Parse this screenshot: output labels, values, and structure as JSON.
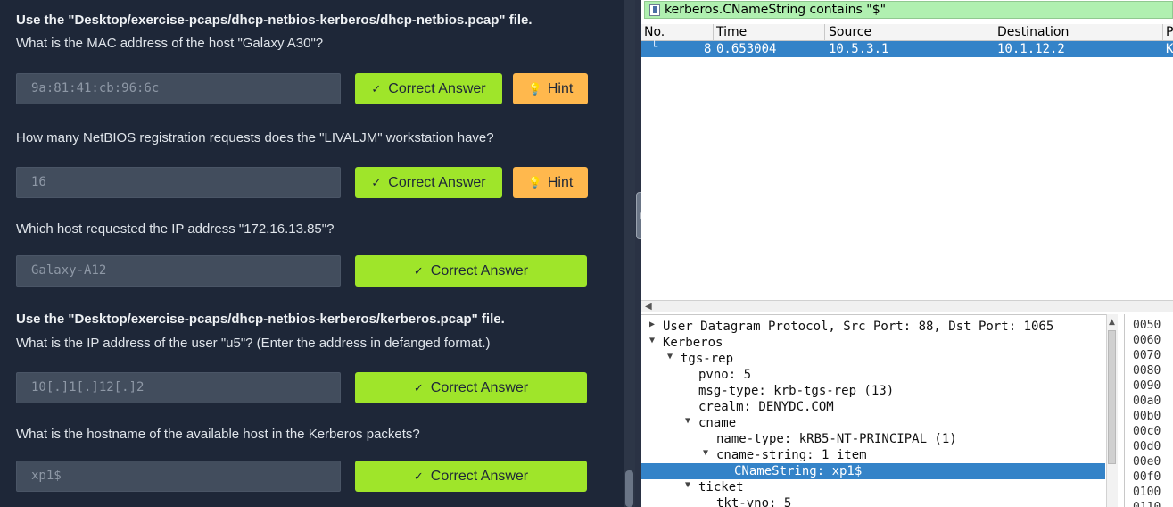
{
  "quiz": {
    "intro1": "Use the \"Desktop/exercise-pcaps/dhcp-netbios-kerberos/dhcp-netbios.pcap\" file.",
    "questions": [
      {
        "text": "What is the MAC address of the host \"Galaxy A30\"?",
        "answer": "9a:81:41:cb:96:6c"
      },
      {
        "text": "How many NetBIOS registration requests does the \"LIVALJM\" workstation have?",
        "answer": "16"
      },
      {
        "text": "Which host requested the IP address \"172.16.13.85\"?",
        "answer": "Galaxy-A12"
      },
      {
        "text": "What is the IP address of the user \"u5\"? (Enter the address in defanged format.)",
        "answer": "10[.]1[.]12[.]2"
      },
      {
        "text": "What is the hostname of the available host in the Kerberos packets?",
        "answer": "xp1$"
      }
    ],
    "intro2": "Use the \"Desktop/exercise-pcaps/dhcp-netbios-kerberos/kerberos.pcap\" file.",
    "correct_label": "Correct Answer",
    "hint_label": "Hint",
    "check_icon": "✓",
    "hint_icon": "💡"
  },
  "wireshark": {
    "filter": "kerberos.CNameString contains \"$\"",
    "columns": [
      "No.",
      "Time",
      "Source",
      "Destination",
      "P"
    ],
    "packet": {
      "no": "8",
      "time": "0.653004",
      "source": "10.5.3.1",
      "destination": "10.1.12.2",
      "proto": "K"
    },
    "details": [
      "User Datagram Protocol, Src Port: 88, Dst Port: 1065",
      "Kerberos",
      "tgs-rep",
      "pvno: 5",
      "msg-type: krb-tgs-rep (13)",
      "crealm: DENYDC.COM",
      "cname",
      "name-type: kRB5-NT-PRINCIPAL (1)",
      "cname-string: 1 item",
      "CNameString: xp1$",
      "ticket",
      "tkt-vno: 5"
    ],
    "hex_offsets": [
      "0050",
      "0060",
      "0070",
      "0080",
      "0090",
      "00a0",
      "00b0",
      "00c0",
      "00d0",
      "00e0",
      "00f0",
      "0100",
      "0110"
    ]
  },
  "colors": {
    "accent_green": "#9fe52a",
    "hint_orange": "#ffb84d",
    "selection_blue": "#3483c8",
    "filter_green": "#b0f0b0"
  }
}
